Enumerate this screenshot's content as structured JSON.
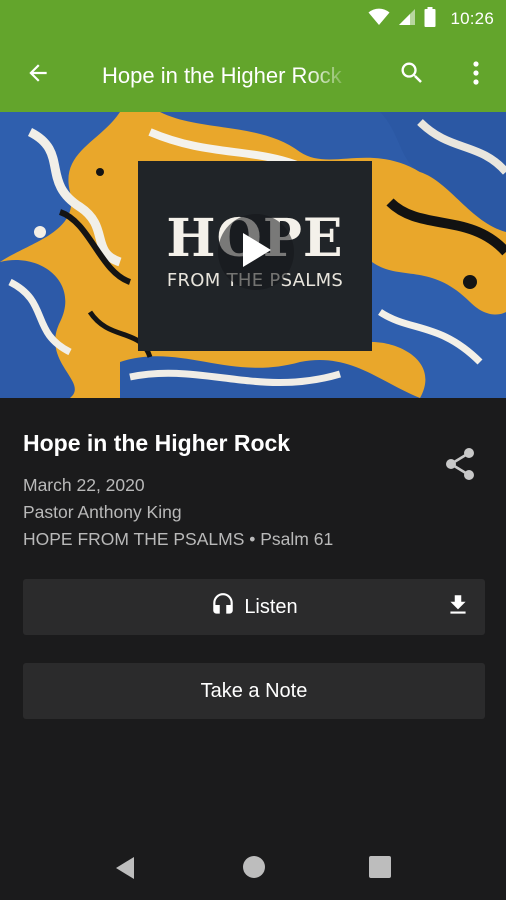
{
  "status_bar": {
    "time": "10:26",
    "icons": [
      "wifi-icon",
      "cell-signal-icon",
      "battery-icon"
    ]
  },
  "app_bar": {
    "title": "Hope in the Higher Rock",
    "icons": [
      "back-arrow-icon",
      "search-icon",
      "more-vert-icon"
    ],
    "color": "#63a52c"
  },
  "artwork": {
    "title": "HOPE",
    "subtitle": "FROM THE PSALMS",
    "play_icon": "play-icon"
  },
  "sermon": {
    "title": "Hope in the Higher Rock",
    "date": "March 22, 2020",
    "speaker": "Pastor Anthony King",
    "series_reference": "HOPE FROM THE PSALMS • Psalm 61"
  },
  "actions": {
    "listen_label": "Listen",
    "listen_icon": "headphones-icon",
    "download_icon": "download-icon",
    "note_label": "Take a Note",
    "share_icon": "share-icon"
  },
  "nav_bar": {
    "icons": [
      "nav-back-icon",
      "nav-home-icon",
      "nav-recents-icon"
    ]
  },
  "colors": {
    "background": "#1b1b1c",
    "button": "#2b2b2c",
    "meta_text": "#b9b9b9"
  }
}
